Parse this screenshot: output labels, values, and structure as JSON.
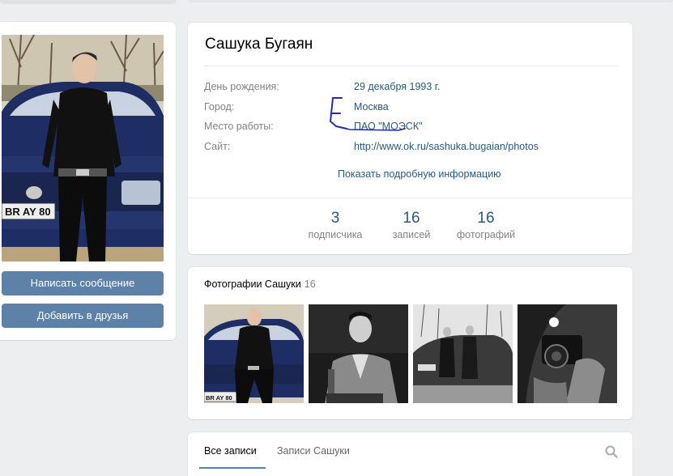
{
  "profile": {
    "name": "Сашука Бугаян",
    "info": [
      {
        "label": "День рождения:",
        "value": "29 декабря 1993 г."
      },
      {
        "label": "Город:",
        "value": "Москва"
      },
      {
        "label": "Место работы:",
        "value": "ПАО \"МОЭСК\""
      },
      {
        "label": "Сайт:",
        "value": "http://www.ok.ru/sashuka.bugaian/photos"
      }
    ],
    "more_link": "Показать подробную информацию",
    "counters": [
      {
        "num": "3",
        "label": "подписчика"
      },
      {
        "num": "16",
        "label": "записей"
      },
      {
        "num": "16",
        "label": "фотографий"
      }
    ]
  },
  "actions": {
    "message": "Написать сообщение",
    "add_friend": "Добавить в друзья"
  },
  "avatar": {
    "plate_text": "BR AY 80"
  },
  "photos": {
    "title": "Фотографии Сашуки",
    "count": "16",
    "thumbs": [
      {
        "kind": "color-car-portrait",
        "plate_text": "BR AY 80"
      },
      {
        "kind": "bw-portrait"
      },
      {
        "kind": "bw-two-men-car"
      },
      {
        "kind": "bw-camera-mirror"
      }
    ]
  },
  "posts": {
    "tabs": [
      "Все записи",
      "Записи Сашуки"
    ],
    "active_tab": 0
  },
  "colors": {
    "link": "#2a5885",
    "button": "#5e81a8",
    "muted": "#828282",
    "background": "#edeef0",
    "annotation_ink": "#1f2fa8"
  },
  "icons": {
    "search": "search-icon"
  }
}
